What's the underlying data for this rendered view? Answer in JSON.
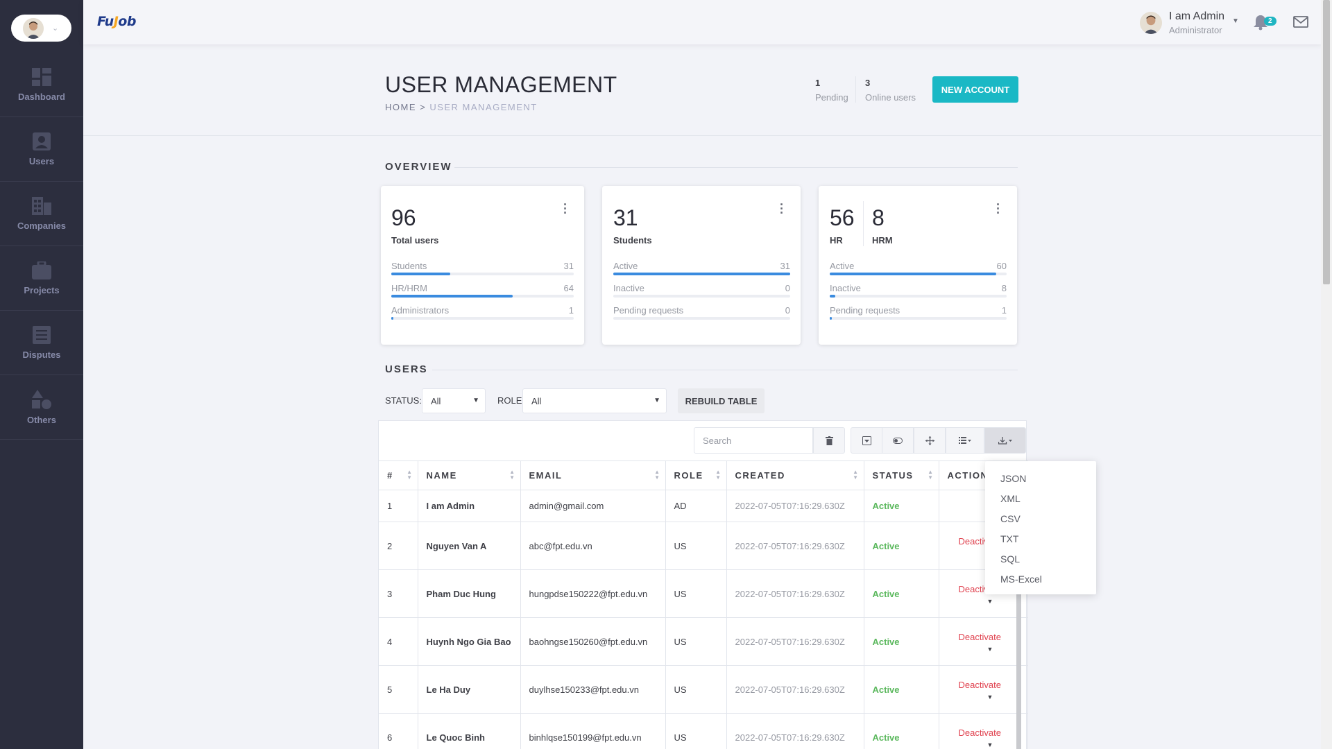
{
  "sidebar": {
    "items": [
      {
        "label": "Dashboard",
        "icon": "dashboard-icon"
      },
      {
        "label": "Users",
        "icon": "user-icon"
      },
      {
        "label": "Companies",
        "icon": "building-icon"
      },
      {
        "label": "Projects",
        "icon": "briefcase-icon"
      },
      {
        "label": "Disputes",
        "icon": "document-icon"
      },
      {
        "label": "Others",
        "icon": "shapes-icon"
      }
    ]
  },
  "header": {
    "logo_prefix": "Fu",
    "logo_j": "J",
    "logo_suffix": "ob",
    "user_name": "I am Admin",
    "user_role": "Administrator",
    "notification_count": "2"
  },
  "subheader": {
    "title": "USER MANAGEMENT",
    "breadcrumb_home": "HOME",
    "breadcrumb_sep": " > ",
    "breadcrumb_current": "USER MANAGEMENT",
    "pending_value": "1",
    "pending_label": "Pending",
    "online_value": "3",
    "online_label": "Online users",
    "new_account_label": "NEW ACCOUNT"
  },
  "overview": {
    "title": "OVERVIEW",
    "cards": [
      {
        "big": "96",
        "caption": "Total users",
        "rows": [
          {
            "label": "Students",
            "value": "31",
            "fraction": 0.323
          },
          {
            "label": "HR/HRM",
            "value": "64",
            "fraction": 0.667
          },
          {
            "label": "Administrators",
            "value": "1",
            "fraction": 0.01
          }
        ]
      },
      {
        "big": "31",
        "caption": "Students",
        "rows": [
          {
            "label": "Active",
            "value": "31",
            "fraction": 1.0
          },
          {
            "label": "Inactive",
            "value": "0",
            "fraction": 0
          },
          {
            "label": "Pending requests",
            "value": "0",
            "fraction": 0
          }
        ]
      },
      {
        "big": "56",
        "caption": "HR",
        "big2": "8",
        "caption2": "HRM",
        "rows": [
          {
            "label": "Active",
            "value": "60",
            "fraction": 0.94
          },
          {
            "label": "Inactive",
            "value": "8",
            "fraction": 0.03
          },
          {
            "label": "Pending requests",
            "value": "1",
            "fraction": 0.01
          }
        ]
      }
    ]
  },
  "users_section": {
    "title": "USERS",
    "status_label": "STATUS:",
    "status_value": "All",
    "role_label": "ROLE:",
    "role_value": "All",
    "rebuild_label": "REBUILD TABLE",
    "search_placeholder": "Search"
  },
  "table": {
    "columns": [
      "#",
      "NAME",
      "EMAIL",
      "ROLE",
      "CREATED",
      "STATUS",
      "ACTION"
    ],
    "rows": [
      {
        "id": "1",
        "name": "I am Admin",
        "email": "admin@gmail.com",
        "role": "AD",
        "created": "2022-07-05T07:16:29.630Z",
        "status": "Active",
        "action": ""
      },
      {
        "id": "2",
        "name": "Nguyen Van A",
        "email": "abc@fpt.edu.vn",
        "role": "US",
        "created": "2022-07-05T07:16:29.630Z",
        "status": "Active",
        "action": "Deactivate"
      },
      {
        "id": "3",
        "name": "Pham Duc Hung",
        "email": "hungpdse150222@fpt.edu.vn",
        "role": "US",
        "created": "2022-07-05T07:16:29.630Z",
        "status": "Active",
        "action": "Deactivate"
      },
      {
        "id": "4",
        "name": "Huynh Ngo Gia Bao",
        "email": "baohngse150260@fpt.edu.vn",
        "role": "US",
        "created": "2022-07-05T07:16:29.630Z",
        "status": "Active",
        "action": "Deactivate"
      },
      {
        "id": "5",
        "name": "Le Ha Duy",
        "email": "duylhse150233@fpt.edu.vn",
        "role": "US",
        "created": "2022-07-05T07:16:29.630Z",
        "status": "Active",
        "action": "Deactivate"
      },
      {
        "id": "6",
        "name": "Le Quoc Binh",
        "email": "binhlqse150199@fpt.edu.vn",
        "role": "US",
        "created": "2022-07-05T07:16:29.630Z",
        "status": "Active",
        "action": "Deactivate"
      }
    ]
  },
  "export_menu": {
    "options": [
      "JSON",
      "XML",
      "CSV",
      "TXT",
      "SQL",
      "MS-Excel"
    ]
  },
  "colors": {
    "sidebar": "#2c2e3e",
    "accent": "#1ab8c5",
    "progress": "#3a8bdf",
    "active_status": "#5bb85d",
    "deactivate": "#e0424f"
  }
}
